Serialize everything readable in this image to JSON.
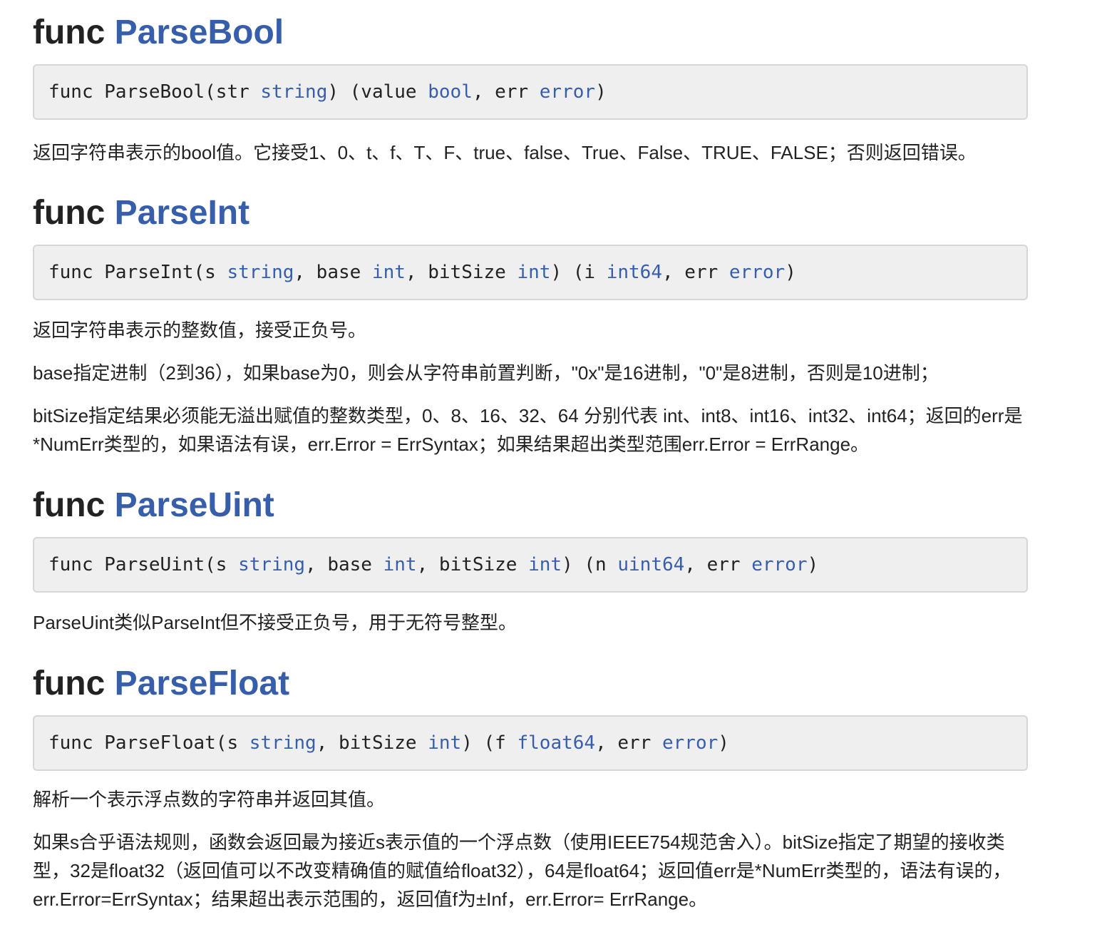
{
  "sections": [
    {
      "heading_kw": "func",
      "heading_name": "ParseBool",
      "sig": [
        {
          "text": "func ParseBool(str ",
          "type": false
        },
        {
          "text": "string",
          "type": true
        },
        {
          "text": ") (value ",
          "type": false
        },
        {
          "text": "bool",
          "type": true
        },
        {
          "text": ", err ",
          "type": false
        },
        {
          "text": "error",
          "type": true
        },
        {
          "text": ")",
          "type": false
        }
      ],
      "paragraphs": [
        "返回字符串表示的bool值。它接受1、0、t、f、T、F、true、false、True、False、TRUE、FALSE；否则返回错误。"
      ]
    },
    {
      "heading_kw": "func",
      "heading_name": "ParseInt",
      "sig": [
        {
          "text": "func ParseInt(s ",
          "type": false
        },
        {
          "text": "string",
          "type": true
        },
        {
          "text": ", base ",
          "type": false
        },
        {
          "text": "int",
          "type": true
        },
        {
          "text": ", bitSize ",
          "type": false
        },
        {
          "text": "int",
          "type": true
        },
        {
          "text": ") (i ",
          "type": false
        },
        {
          "text": "int64",
          "type": true
        },
        {
          "text": ", err ",
          "type": false
        },
        {
          "text": "error",
          "type": true
        },
        {
          "text": ")",
          "type": false
        }
      ],
      "paragraphs": [
        "返回字符串表示的整数值，接受正负号。",
        "base指定进制（2到36），如果base为0，则会从字符串前置判断，\"0x\"是16进制，\"0\"是8进制，否则是10进制；",
        "bitSize指定结果必须能无溢出赋值的整数类型，0、8、16、32、64 分别代表 int、int8、int16、int32、int64；返回的err是*NumErr类型的，如果语法有误，err.Error = ErrSyntax；如果结果超出类型范围err.Error = ErrRange。"
      ]
    },
    {
      "heading_kw": "func",
      "heading_name": "ParseUint",
      "sig": [
        {
          "text": "func ParseUint(s ",
          "type": false
        },
        {
          "text": "string",
          "type": true
        },
        {
          "text": ", base ",
          "type": false
        },
        {
          "text": "int",
          "type": true
        },
        {
          "text": ", bitSize ",
          "type": false
        },
        {
          "text": "int",
          "type": true
        },
        {
          "text": ") (n ",
          "type": false
        },
        {
          "text": "uint64",
          "type": true
        },
        {
          "text": ", err ",
          "type": false
        },
        {
          "text": "error",
          "type": true
        },
        {
          "text": ")",
          "type": false
        }
      ],
      "paragraphs": [
        "ParseUint类似ParseInt但不接受正负号，用于无符号整型。"
      ]
    },
    {
      "heading_kw": "func",
      "heading_name": "ParseFloat",
      "sig": [
        {
          "text": "func ParseFloat(s ",
          "type": false
        },
        {
          "text": "string",
          "type": true
        },
        {
          "text": ", bitSize ",
          "type": false
        },
        {
          "text": "int",
          "type": true
        },
        {
          "text": ") (f ",
          "type": false
        },
        {
          "text": "float64",
          "type": true
        },
        {
          "text": ", err ",
          "type": false
        },
        {
          "text": "error",
          "type": true
        },
        {
          "text": ")",
          "type": false
        }
      ],
      "paragraphs": [
        "解析一个表示浮点数的字符串并返回其值。",
        "如果s合乎语法规则，函数会返回最为接近s表示值的一个浮点数（使用IEEE754规范舍入）。bitSize指定了期望的接收类型，32是float32（返回值可以不改变精确值的赋值给float32），64是float64；返回值err是*NumErr类型的，语法有误的，err.Error=ErrSyntax；结果超出表示范围的，返回值f为±Inf，err.Error= ErrRange。"
      ]
    }
  ],
  "colors": {
    "link": "#375eab",
    "text": "#222222",
    "code_bg": "#efefef",
    "code_border": "#d6d6d6"
  }
}
